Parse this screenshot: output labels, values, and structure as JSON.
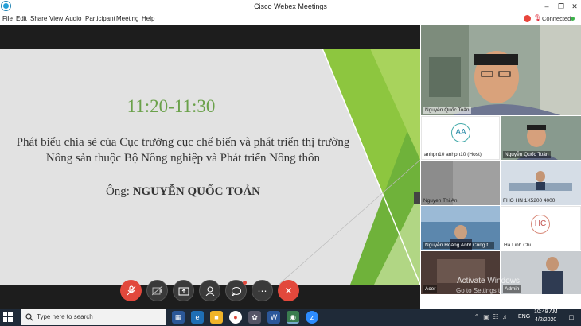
{
  "window": {
    "title": "Cisco Webex Meetings"
  },
  "menu": [
    "File",
    "Edit",
    "Share",
    "View",
    "Audio",
    "Participant",
    "Meeting",
    "Help"
  ],
  "status": {
    "connection": "Connected"
  },
  "slide": {
    "time": "11:20-11:30",
    "line1": "Phát biểu chia sẻ của Cục trưởng cục chế biến và phát triển thị trường",
    "line2": "Nông sản thuộc Bộ Nông nghiệp và Phát triển Nông thôn",
    "speaker_prefix": "Ông: ",
    "speaker_name": "NGUYỄN QUỐC TOẢN"
  },
  "participants": {
    "active_speaker": "Nguyễn Quốc Toản",
    "tiles": [
      {
        "name": "anhpn10 anhpn10 (Host)",
        "initials": "AA"
      },
      {
        "name": "Nguyễn Quốc Toản"
      },
      {
        "name": "Nguyen Thi An"
      },
      {
        "name": "FHO HN 1X5200 4000"
      },
      {
        "name": "Nguyễn Hoàng Anh/ Công t..."
      },
      {
        "name": "Hà Linh Chi",
        "initials": "HC"
      },
      {
        "name": "Acer"
      },
      {
        "name": "Admin"
      }
    ]
  },
  "watermark": {
    "line1": "Activate Windows",
    "line2": "Go to Settings t"
  },
  "taskbar": {
    "search_placeholder": "Type here to search",
    "language": "ENG",
    "time": "10:49 AM",
    "date": "4/2/2020"
  },
  "colors": {
    "accent_red": "#e2483c",
    "connected_green": "#3cb34a",
    "slide_green": "#6aa14a"
  }
}
